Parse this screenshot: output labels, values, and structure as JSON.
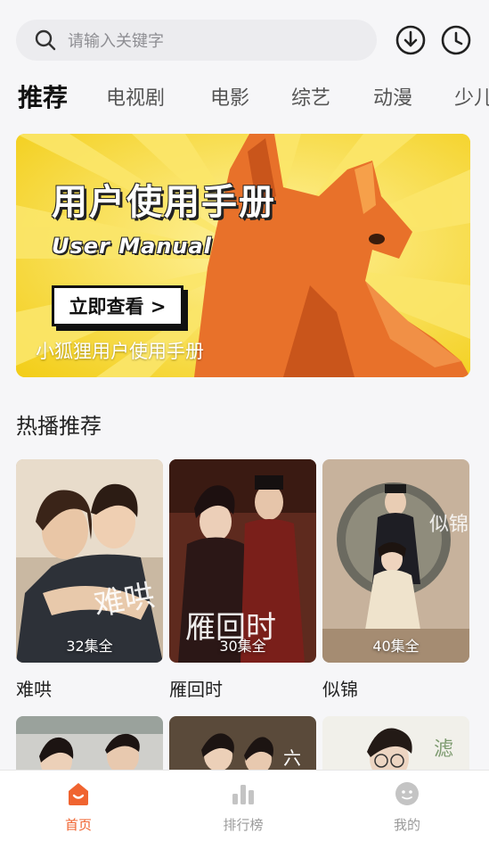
{
  "search": {
    "placeholder": "请输入关键字"
  },
  "header_icons": {
    "download": "download-icon",
    "history": "history-clock-icon"
  },
  "tabs": [
    {
      "label": "推荐",
      "active": true
    },
    {
      "label": "电视剧"
    },
    {
      "label": "电影"
    },
    {
      "label": "综艺"
    },
    {
      "label": "动漫"
    },
    {
      "label": "少儿"
    }
  ],
  "banner": {
    "title": "用户使用手册",
    "subtitle": "User Manual",
    "cta": "立即查看 >",
    "caption": "小狐狸用户使用手册",
    "colors": {
      "background": "#f4d21c",
      "fox": "#e8712a"
    }
  },
  "section": {
    "title": "热播推荐"
  },
  "cards": [
    {
      "name": "难哄",
      "episodes": "32集全",
      "calligraphy": "难哄"
    },
    {
      "name": "雁回时",
      "episodes": "30集全",
      "calligraphy": "雁回时"
    },
    {
      "name": "似锦",
      "episodes": "40集全",
      "calligraphy": "似锦"
    }
  ],
  "poster_text": {
    "card5": "六",
    "card6": "滤"
  },
  "bottom_nav": [
    {
      "label": "首页",
      "icon": "home-icon",
      "active": true
    },
    {
      "label": "排行榜",
      "icon": "ranking-bars-icon"
    },
    {
      "label": "我的",
      "icon": "profile-face-icon"
    }
  ],
  "colors": {
    "accent": "#f06430",
    "inactive": "#9a9a9a"
  }
}
